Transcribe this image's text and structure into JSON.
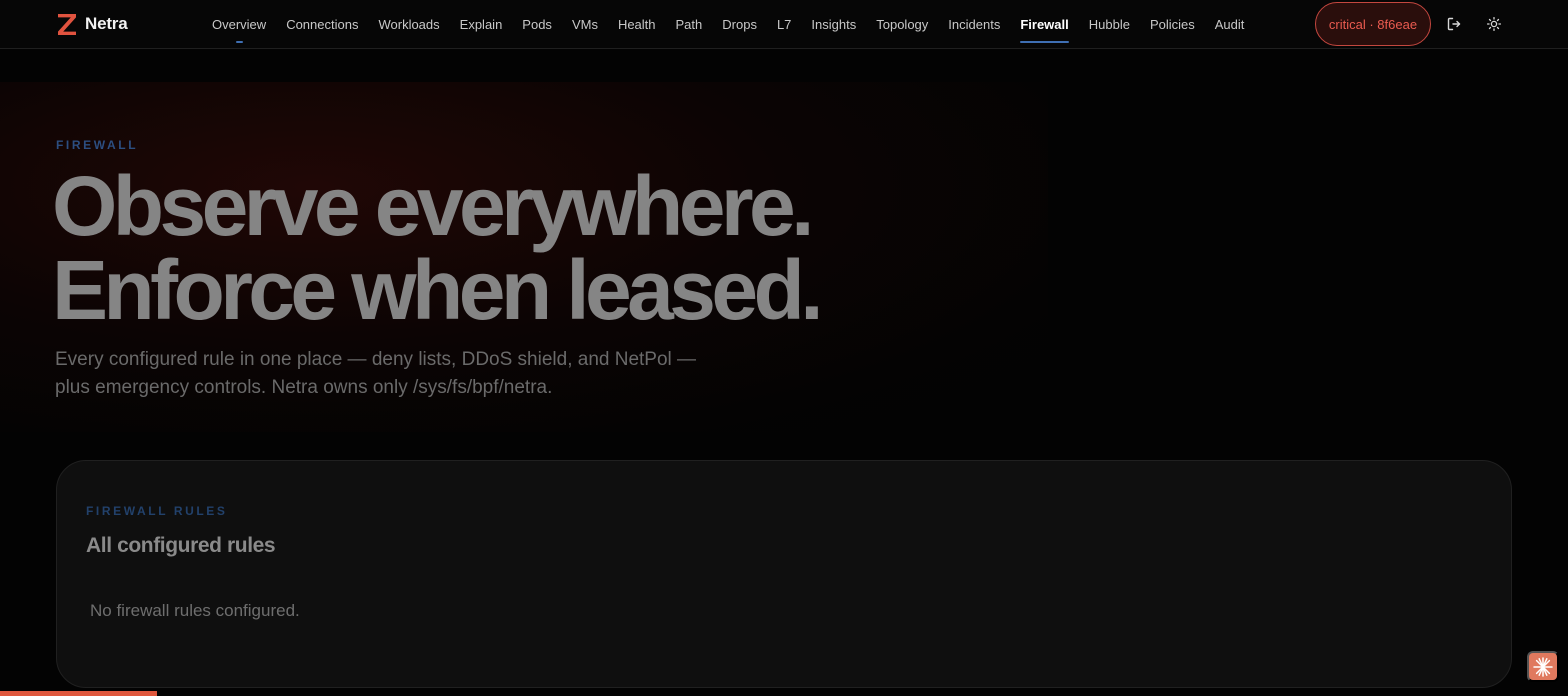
{
  "brand": {
    "name": "Netra",
    "logo_icon": "z-logo-icon",
    "accent": "#e0533f"
  },
  "nav": {
    "items": [
      {
        "label": "Overview"
      },
      {
        "label": "Connections"
      },
      {
        "label": "Workloads"
      },
      {
        "label": "Explain"
      },
      {
        "label": "Pods"
      },
      {
        "label": "VMs"
      },
      {
        "label": "Health"
      },
      {
        "label": "Path"
      },
      {
        "label": "Drops"
      },
      {
        "label": "L7"
      },
      {
        "label": "Insights"
      },
      {
        "label": "Topology"
      },
      {
        "label": "Incidents"
      },
      {
        "label": "Firewall"
      },
      {
        "label": "Hubble"
      },
      {
        "label": "Policies"
      },
      {
        "label": "Audit"
      }
    ],
    "active": "Firewall",
    "active_color": "#3f6fb3"
  },
  "status": {
    "label": "critical · 8f6eae",
    "color": "#ea5b50"
  },
  "actions": {
    "logout_icon": "logout-icon",
    "theme_icon": "sun-icon"
  },
  "hero": {
    "eyebrow": "FIREWALL",
    "title_line1": "Observe everywhere.",
    "title_line2": "Enforce when leased.",
    "subtitle_line1": "Every configured rule in one place — deny lists, DDoS shield, and NetPol —",
    "subtitle_line2": "plus emergency controls. Netra owns only /sys/fs/bpf/netra."
  },
  "rules_card": {
    "eyebrow": "FIREWALL RULES",
    "title": "All configured rules",
    "empty_message": "No firewall rules configured."
  },
  "page_progress": 0.1,
  "assistant": {
    "icon": "sparkle-icon",
    "color": "#e0795e"
  }
}
